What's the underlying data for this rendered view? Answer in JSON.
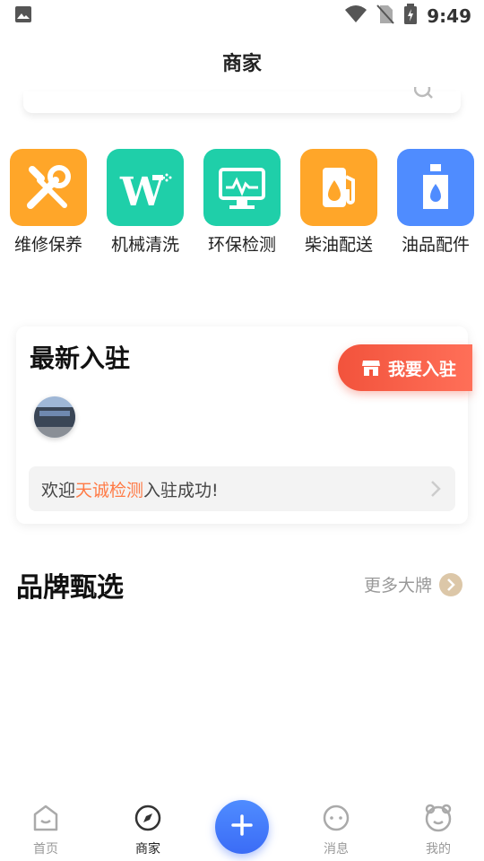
{
  "status": {
    "time": "9:49"
  },
  "header": {
    "title": "商家"
  },
  "categories": [
    {
      "label": "维修保养",
      "color": "#ffa629",
      "icon": "wrench-screwdriver-icon"
    },
    {
      "label": "机械清洗",
      "color": "#1fcfa9",
      "icon": "washer-icon"
    },
    {
      "label": "环保检测",
      "color": "#1fcfa9",
      "icon": "monitor-icon"
    },
    {
      "label": "柴油配送",
      "color": "#ffa629",
      "icon": "fuel-pump-icon"
    },
    {
      "label": "油品配件",
      "color": "#4f8cff",
      "icon": "oil-can-icon"
    }
  ],
  "new_join": {
    "title": "最新入驻",
    "join_button": "我要入驻",
    "welcome_prefix": "欢迎",
    "merchant_name": "天诚检测",
    "welcome_suffix": "入驻成功!"
  },
  "brand": {
    "title": "品牌甄选",
    "more": "更多大牌"
  },
  "tabbar": {
    "items": [
      {
        "label": "首页",
        "icon": "home-icon"
      },
      {
        "label": "商家",
        "icon": "compass-icon"
      },
      {
        "label": "消息",
        "icon": "message-icon"
      },
      {
        "label": "我的",
        "icon": "profile-icon"
      }
    ],
    "active": "商家"
  }
}
